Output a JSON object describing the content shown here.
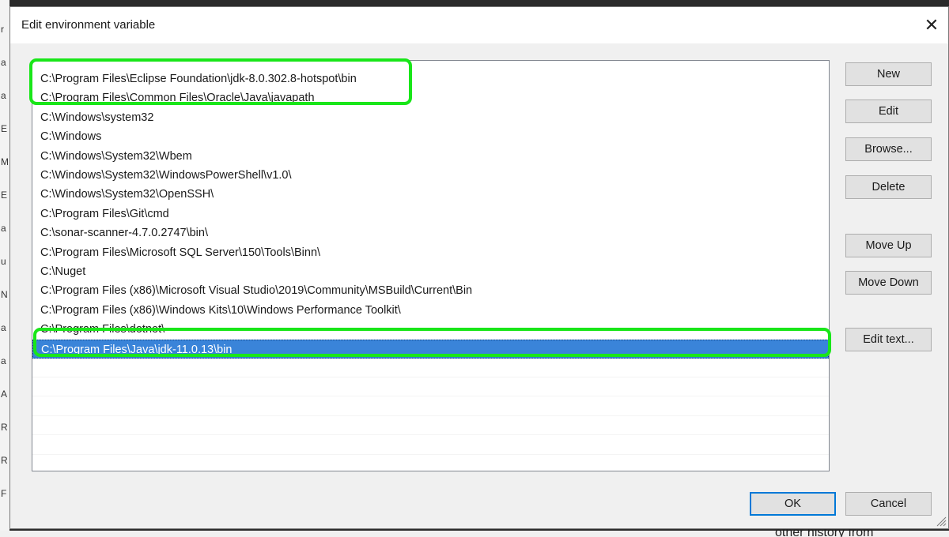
{
  "dialog": {
    "title": "Edit environment variable",
    "close_label": "✕"
  },
  "paths": [
    "C:\\Program Files\\Eclipse Foundation\\jdk-8.0.302.8-hotspot\\bin",
    "C:\\Program Files\\Common Files\\Oracle\\Java\\javapath",
    "C:\\Windows\\system32",
    "C:\\Windows",
    "C:\\Windows\\System32\\Wbem",
    "C:\\Windows\\System32\\WindowsPowerShell\\v1.0\\",
    "C:\\Windows\\System32\\OpenSSH\\",
    "C:\\Program Files\\Git\\cmd",
    "C:\\sonar-scanner-4.7.0.2747\\bin\\",
    "C:\\Program Files\\Microsoft SQL Server\\150\\Tools\\Binn\\",
    "C:\\Nuget",
    "C:\\Program Files (x86)\\Microsoft Visual Studio\\2019\\Community\\MSBuild\\Current\\Bin",
    "C:\\Program Files (x86)\\Windows Kits\\10\\Windows Performance Toolkit\\",
    "C:\\Program Files\\dotnet\\",
    "C:\\Program Files\\Java\\jdk-11.0.13\\bin"
  ],
  "selected_index": 14,
  "buttons": {
    "new": "New",
    "edit": "Edit",
    "browse": "Browse...",
    "delete": "Delete",
    "move_up": "Move Up",
    "move_down": "Move Down",
    "edit_text": "Edit text...",
    "ok": "OK",
    "cancel": "Cancel"
  },
  "background": {
    "left_fragments": [
      "r",
      "a",
      "a",
      "E",
      "M",
      "E",
      "a",
      "u",
      "N",
      "a",
      "a",
      "A",
      "R",
      "R",
      "F"
    ],
    "bottom_right_text": "other history from"
  },
  "colors": {
    "selection": "#3a84d9",
    "highlight": "#19e619",
    "default_button_border": "#0078d7"
  }
}
